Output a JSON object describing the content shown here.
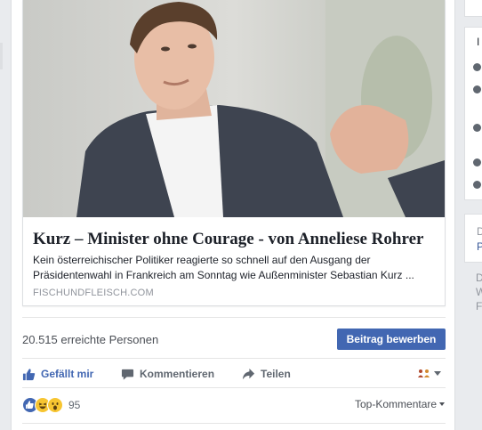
{
  "link": {
    "title": "Kurz – Minister ohne Courage - von Anneliese Rohrer",
    "description": "Kein österreichischer Politiker reagierte so schnell auf den Ausgang der Präsidentenwahl in Frankreich am Sonntag wie Außenminister Sebastian Kurz ...",
    "domain": "FISCHUNDFLEISCH.COM"
  },
  "reach": {
    "text": "20.515 erreichte Personen"
  },
  "boost": {
    "label": "Beitrag bewerben"
  },
  "actions": {
    "like": "Gefällt mir",
    "comment": "Kommentieren",
    "share": "Teilen"
  },
  "reactions": {
    "count": "95",
    "types": [
      "like",
      "haha",
      "wow"
    ]
  },
  "comments_sort": {
    "label": "Top-Kommentare"
  },
  "right_rail": {
    "chars": [
      "I",
      "D",
      "P",
      "D",
      "W",
      "F"
    ]
  },
  "colors": {
    "brand": "#4267b2",
    "text_secondary": "#606770",
    "background": "#e9ebee"
  }
}
